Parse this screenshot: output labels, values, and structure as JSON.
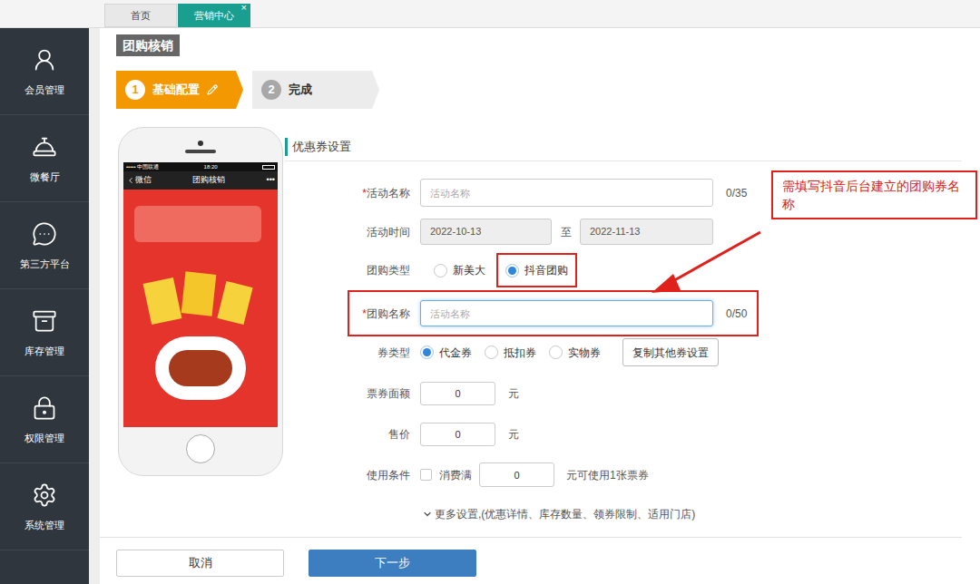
{
  "top_tabs": [
    {
      "label": "首页",
      "selected": false,
      "closable": false
    },
    {
      "label": "营销中心",
      "selected": true,
      "closable": true,
      "close": "×"
    }
  ],
  "sidebar": {
    "items": [
      {
        "label": "会员管理",
        "selected": false
      },
      {
        "label": "微餐厅",
        "selected": false
      },
      {
        "label": "第三方平台",
        "selected": false
      },
      {
        "label": "库存管理",
        "selected": false
      },
      {
        "label": "权限管理",
        "selected": false
      },
      {
        "label": "系统管理",
        "selected": false
      }
    ]
  },
  "page_title": "团购核销",
  "steps": [
    {
      "number": "1",
      "label": "基础配置",
      "selected": true
    },
    {
      "number": "2",
      "label": "完成",
      "selected": false
    }
  ],
  "phone": {
    "signal": "•••••",
    "carrier": "中国联通",
    "time": "18:20",
    "back": "微信",
    "title": "团购核销",
    "more": "•••"
  },
  "section": "优惠券设置",
  "required_mark": "*",
  "form": {
    "activity_name": {
      "label": "活动名称",
      "required": true,
      "placeholder": "活动名称",
      "counter": "0/35"
    },
    "activity_time": {
      "label": "活动时间",
      "start": "2022-10-13",
      "separator": "至",
      "end": "2022-11-13",
      "disabled": true
    },
    "group_type": {
      "label": "团购类型",
      "options": [
        {
          "label": "新美大",
          "selected": false,
          "highlighted": false
        },
        {
          "label": "抖音团购",
          "selected": true,
          "highlighted": true
        }
      ]
    },
    "group_name": {
      "label": "团购名称",
      "required": true,
      "placeholder": "活动名称",
      "counter": "0/50",
      "focused": true,
      "highlighted": true
    },
    "coupon_type": {
      "label": "券类型",
      "options": [
        {
          "label": "代金券",
          "selected": true
        },
        {
          "label": "抵扣券",
          "selected": false
        },
        {
          "label": "实物券",
          "selected": false
        }
      ],
      "button": "复制其他券设置"
    },
    "face_value": {
      "label": "票券面额",
      "value": "0",
      "unit": "元"
    },
    "price": {
      "label": "售价",
      "value": "0",
      "unit": "元"
    },
    "condition": {
      "label": "使用条件",
      "checked": false,
      "prefix": "消费满",
      "value": "0",
      "suffix": "元可使用1张票券"
    },
    "more": {
      "label": "更多设置,(优惠详情、库存数量、领券限制、适用门店)",
      "expanded": false
    }
  },
  "buttons": [
    {
      "label": "取消",
      "kind": "secondary"
    },
    {
      "label": "下一步",
      "kind": "primary"
    }
  ],
  "annotation": {
    "text": "需填写抖音后台建立的团购券名称"
  }
}
